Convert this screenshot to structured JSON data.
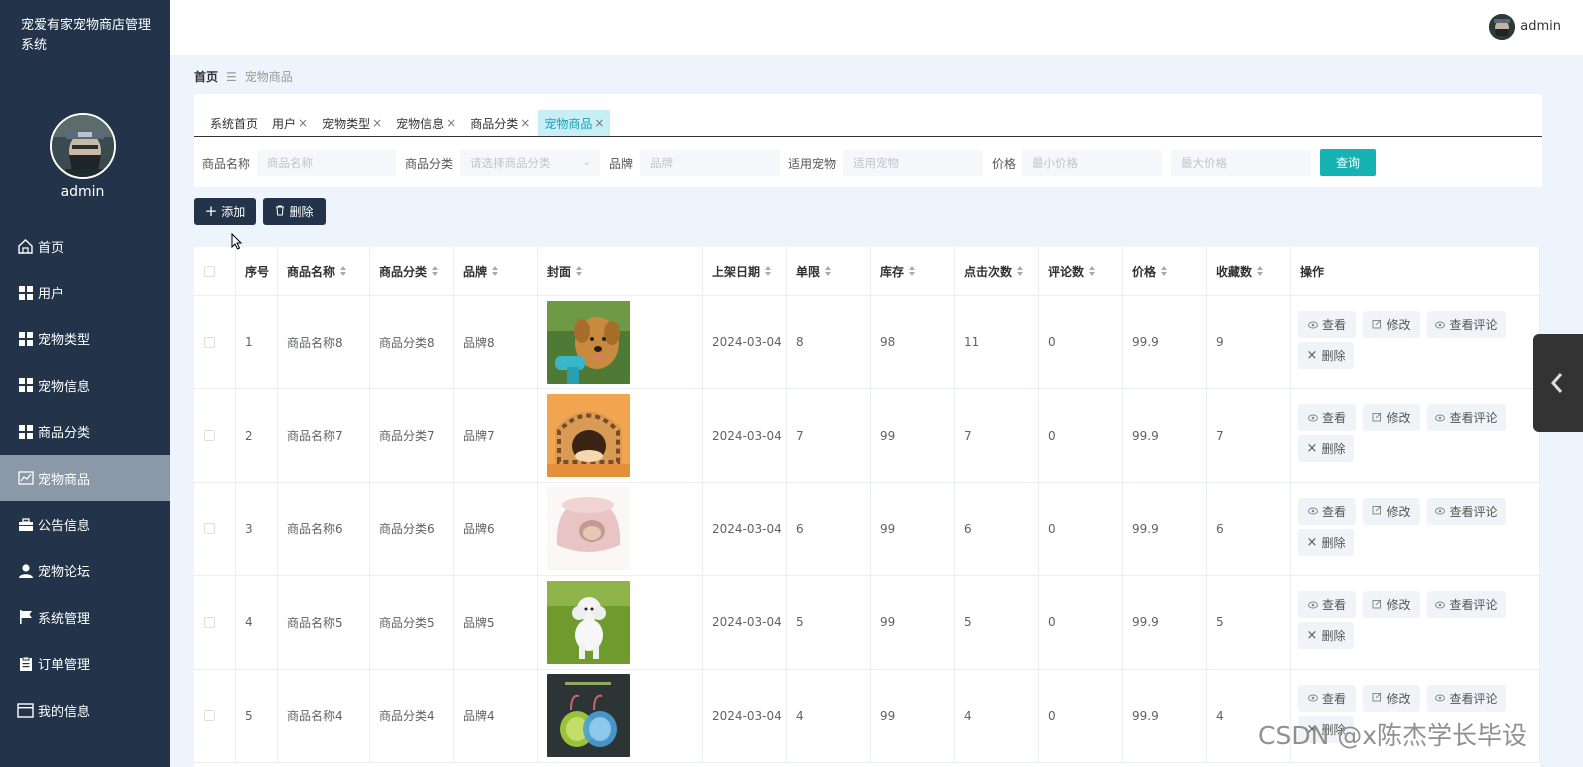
{
  "app": {
    "title": "宠爱有家宠物商店管理系统",
    "user": "admin"
  },
  "sidebar": {
    "username": "admin",
    "items": [
      {
        "label": "首页",
        "icon": "home-icon"
      },
      {
        "label": "用户",
        "icon": "grid-icon"
      },
      {
        "label": "宠物类型",
        "icon": "grid-icon"
      },
      {
        "label": "宠物信息",
        "icon": "grid-icon"
      },
      {
        "label": "商品分类",
        "icon": "grid-icon"
      },
      {
        "label": "宠物商品",
        "icon": "chart-icon",
        "active": true
      },
      {
        "label": "公告信息",
        "icon": "briefcase-icon"
      },
      {
        "label": "宠物论坛",
        "icon": "person-icon"
      },
      {
        "label": "系统管理",
        "icon": "flag-icon"
      },
      {
        "label": "订单管理",
        "icon": "clipboard-icon"
      },
      {
        "label": "我的信息",
        "icon": "card-icon"
      }
    ]
  },
  "topbar": {
    "user": "admin"
  },
  "breadcrumb": {
    "home": "首页",
    "separator": "☰",
    "current": "宠物商品"
  },
  "tabs": [
    {
      "label": "系统首页",
      "closable": false
    },
    {
      "label": "用户",
      "closable": true
    },
    {
      "label": "宠物类型",
      "closable": true
    },
    {
      "label": "宠物信息",
      "closable": true
    },
    {
      "label": "商品分类",
      "closable": true
    },
    {
      "label": "宠物商品",
      "closable": true,
      "active": true
    }
  ],
  "search": {
    "name_label": "商品名称",
    "name_placeholder": "商品名称",
    "category_label": "商品分类",
    "category_placeholder": "请选择商品分类",
    "brand_label": "品牌",
    "brand_placeholder": "品牌",
    "pet_label": "适用宠物",
    "pet_placeholder": "适用宠物",
    "price_label": "价格",
    "min_placeholder": "最小价格",
    "max_placeholder": "最大价格",
    "query_button": "查询"
  },
  "actions": {
    "add": "添加",
    "delete": "删除"
  },
  "table": {
    "headers": [
      "序号",
      "商品名称",
      "商品分类",
      "品牌",
      "封面",
      "上架日期",
      "单限",
      "库存",
      "点击次数",
      "评论数",
      "价格",
      "收藏数",
      "操作"
    ],
    "op_labels": {
      "view": "查看",
      "edit": "修改",
      "comments": "查看评论",
      "delete": "删除"
    },
    "rows": [
      {
        "no": "1",
        "name": "商品名称8",
        "category": "商品分类8",
        "brand": "品牌8",
        "cover": "golden-retriever-photo",
        "date": "2024-03-04",
        "limit": "8",
        "stock": "98",
        "clicks": "11",
        "comments": "0",
        "price": "99.9",
        "favorites": "9"
      },
      {
        "no": "2",
        "name": "商品名称7",
        "category": "商品分类7",
        "brand": "品牌7",
        "cover": "pet-house-photo",
        "date": "2024-03-04",
        "limit": "7",
        "stock": "99",
        "clicks": "7",
        "comments": "0",
        "price": "99.9",
        "favorites": "7"
      },
      {
        "no": "3",
        "name": "商品名称6",
        "category": "商品分类6",
        "brand": "品牌6",
        "cover": "pink-pet-bed-photo",
        "date": "2024-03-04",
        "limit": "6",
        "stock": "99",
        "clicks": "6",
        "comments": "0",
        "price": "99.9",
        "favorites": "6"
      },
      {
        "no": "4",
        "name": "商品名称5",
        "category": "商品分类5",
        "brand": "品牌5",
        "cover": "white-poodle-photo",
        "date": "2024-03-04",
        "limit": "5",
        "stock": "99",
        "clicks": "5",
        "comments": "0",
        "price": "99.9",
        "favorites": "5"
      },
      {
        "no": "5",
        "name": "商品名称4",
        "category": "商品分类4",
        "brand": "品牌4",
        "cover": "pet-bowls-photo",
        "date": "2024-03-04",
        "limit": "4",
        "stock": "99",
        "clicks": "4",
        "comments": "0",
        "price": "99.9",
        "favorites": "4"
      }
    ]
  },
  "watermark": "CSDN @x陈杰学长毕设",
  "colors": {
    "sidebar": "#23344a",
    "accent": "#17b3b3",
    "active_tab": "#c8eef6"
  }
}
